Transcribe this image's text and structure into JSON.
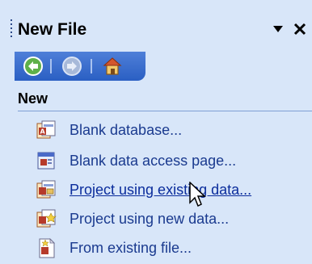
{
  "pane": {
    "title": "New File",
    "dropdown_icon": "triangle-down-icon",
    "close_icon": "close-icon"
  },
  "nav": {
    "back_icon": "back-arrow-icon",
    "forward_icon": "forward-arrow-icon",
    "home_icon": "home-icon"
  },
  "section": {
    "label": "New",
    "items": [
      {
        "label": "Blank database...",
        "icon": "blank-database-icon"
      },
      {
        "label": "Blank data access page...",
        "icon": "data-access-page-icon"
      },
      {
        "label": "Project using existing data...",
        "icon": "project-existing-data-icon"
      },
      {
        "label": "Project using new data...",
        "icon": "project-new-data-icon"
      },
      {
        "label": "From existing file...",
        "icon": "existing-file-icon"
      }
    ]
  },
  "colors": {
    "pane_background": "#d8e6f9",
    "nav_bar": "#2a5fc3",
    "link_text": "#1a3a8f"
  }
}
